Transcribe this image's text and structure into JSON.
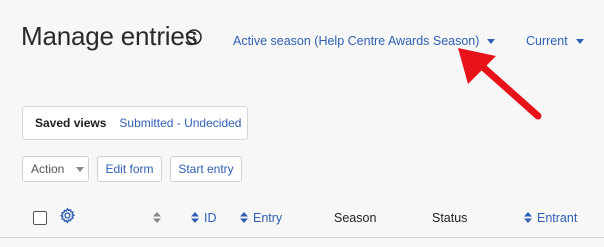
{
  "header": {
    "title": "Manage entries",
    "season_filter": "Active season (Help Centre Awards Season)",
    "period_filter": "Current"
  },
  "saved_views": {
    "label": "Saved views",
    "value": "Submitted - Undecided"
  },
  "toolbar": {
    "action_label": "Action",
    "edit_form_label": "Edit form",
    "start_entry_label": "Start entry"
  },
  "table": {
    "columns": [
      "ID",
      "Entry",
      "Season",
      "Status",
      "Entrant"
    ]
  },
  "colors": {
    "link": "#2e5fb3",
    "annotation_arrow": "#e8121b",
    "background": "#f7f7f7"
  }
}
